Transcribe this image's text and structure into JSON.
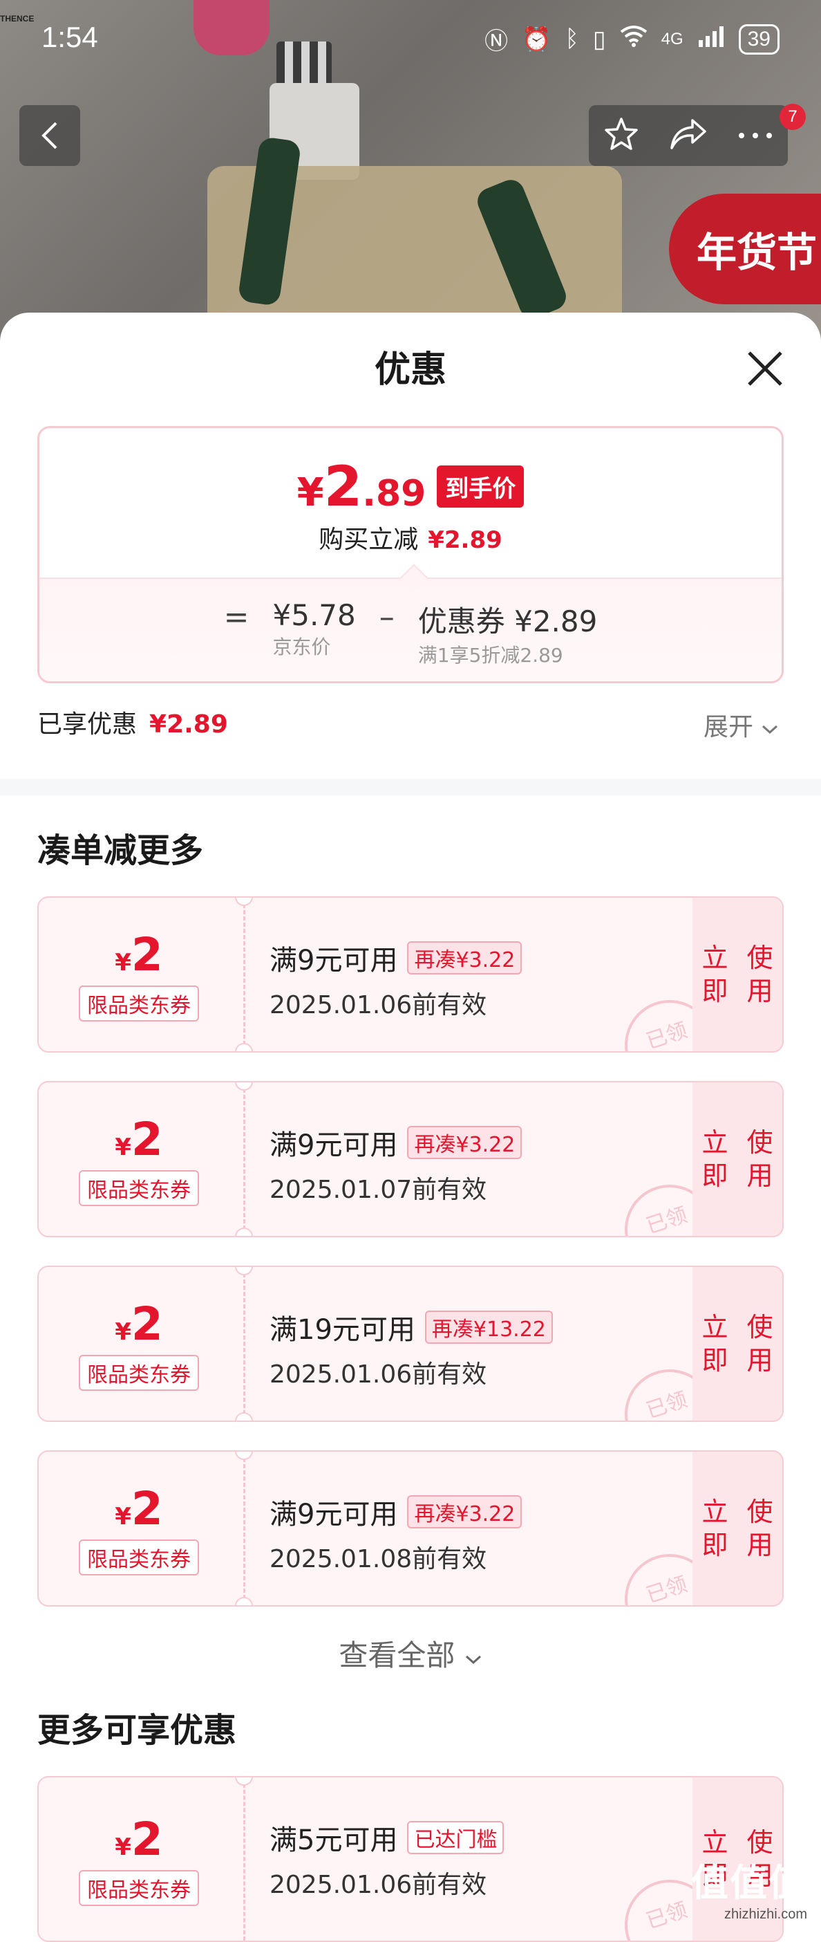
{
  "status_bar": {
    "time": "1:54",
    "network": "4G",
    "battery": "39"
  },
  "background": {
    "brand_text": "THENCE",
    "festival_text": "年货节"
  },
  "nav": {
    "badge_count": "7"
  },
  "sheet": {
    "title": "优惠"
  },
  "price_card": {
    "currency": "¥",
    "price_int": "2",
    "price_dec": ".89",
    "tag": "到手价",
    "sub_label": "购买立减",
    "sub_value": "¥2.89",
    "formula": {
      "eq": "=",
      "base_price": "¥5.78",
      "base_label": "京东价",
      "minus": "–",
      "coupon_price": "优惠券 ¥2.89",
      "coupon_desc": "满1享5折减2.89"
    }
  },
  "enjoyed": {
    "label": "已享优惠",
    "value": "¥2.89",
    "expand": "展开"
  },
  "section1": {
    "title": "凑单减更多",
    "coupons": [
      {
        "currency": "¥",
        "amount": "2",
        "kind": "限品类东券",
        "condition": "满9元可用",
        "chip": "再凑¥3.22",
        "date": "2025.01.06前有效",
        "action": "立即使用",
        "stamp": "已领"
      },
      {
        "currency": "¥",
        "amount": "2",
        "kind": "限品类东券",
        "condition": "满9元可用",
        "chip": "再凑¥3.22",
        "date": "2025.01.07前有效",
        "action": "立即使用",
        "stamp": "已领"
      },
      {
        "currency": "¥",
        "amount": "2",
        "kind": "限品类东券",
        "condition": "满19元可用",
        "chip": "再凑¥13.22",
        "date": "2025.01.06前有效",
        "action": "立即使用",
        "stamp": "已领"
      },
      {
        "currency": "¥",
        "amount": "2",
        "kind": "限品类东券",
        "condition": "满9元可用",
        "chip": "再凑¥3.22",
        "date": "2025.01.08前有效",
        "action": "立即使用",
        "stamp": "已领"
      }
    ],
    "view_all": "查看全部"
  },
  "section2": {
    "title": "更多可享优惠",
    "coupons": [
      {
        "currency": "¥",
        "amount": "2",
        "kind": "限品类东券",
        "condition": "满5元可用",
        "chip": "已达门槛",
        "date": "2025.01.06前有效",
        "action": "立即使用",
        "stamp": "已领"
      }
    ]
  },
  "watermark": {
    "logo": "值值值",
    "url": "zhizhizhi.com"
  },
  "colors": {
    "accent": "#e3162e",
    "coupon_bg": "#fff5f7",
    "coupon_border": "#f7cbd3"
  }
}
